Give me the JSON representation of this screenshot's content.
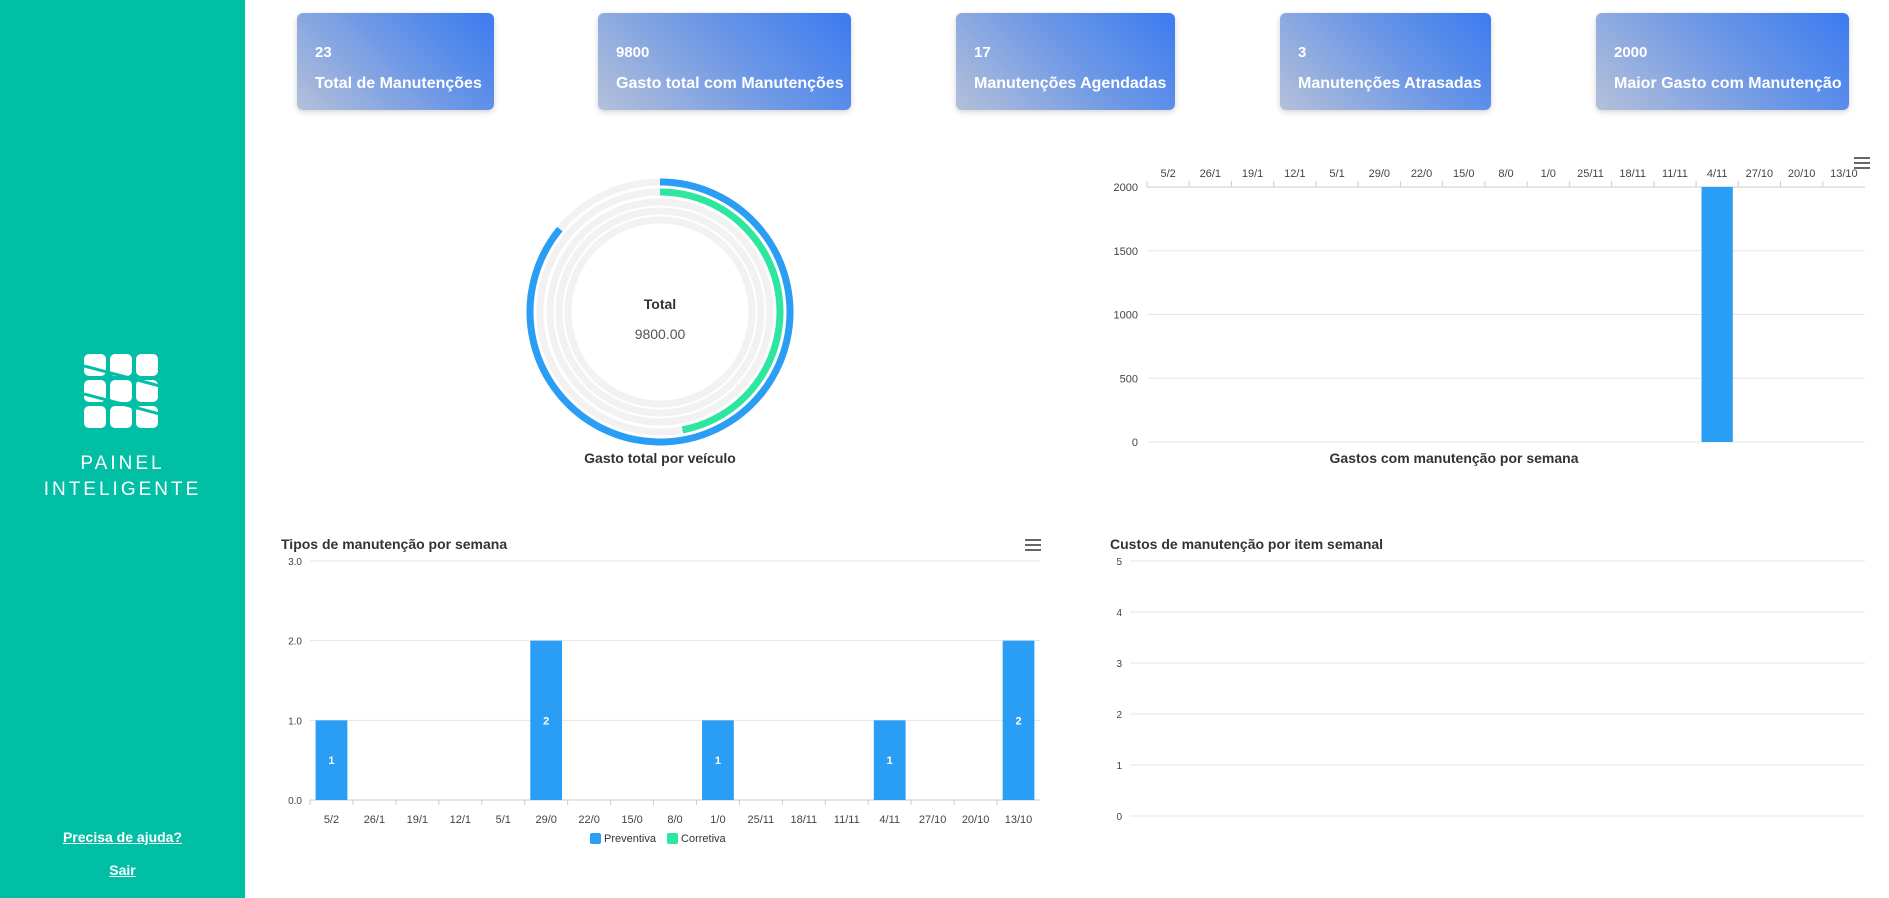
{
  "sidebar": {
    "brand_line1": "PAINEL",
    "brand_line2": "INTELIGENTE",
    "help_label": "Precisa de ajuda?",
    "logout_label": "Sair",
    "background": "#00bfa5"
  },
  "cards": [
    {
      "value": "23",
      "label": "Total de Manutenções"
    },
    {
      "value": "9800",
      "label": "Gasto total com Manutenções"
    },
    {
      "value": "17",
      "label": "Manutenções Agendadas"
    },
    {
      "value": "3",
      "label": "Manutenções Atrasadas"
    },
    {
      "value": "2000",
      "label": "Maior Gasto com Manutenção"
    }
  ],
  "charts": {
    "radial": {
      "center_title": "Total",
      "center_value": "9800.00",
      "caption": "Gasto total por veículo"
    },
    "weekly_cost": {
      "caption": "Gastos com manutenção por semana"
    },
    "types": {
      "title": "Tipos de manutenção por semana"
    },
    "items": {
      "title": "Custos de manutenção por item semanal"
    }
  },
  "chart_data": [
    {
      "type": "radialBar",
      "title": "Gasto total por veículo",
      "center_label": "Total",
      "center_value": "9800.00",
      "series_fraction": [
        0.86,
        0.47,
        0,
        0,
        0
      ],
      "colors": [
        "#2a9df4",
        "#2ee6a0"
      ]
    },
    {
      "type": "bar",
      "title": "Gastos com manutenção por semana",
      "categories": [
        "5/2",
        "26/1",
        "19/1",
        "12/1",
        "5/1",
        "29/0",
        "22/0",
        "15/0",
        "8/0",
        "1/0",
        "25/11",
        "18/11",
        "11/11",
        "4/11",
        "27/10",
        "20/10",
        "13/10"
      ],
      "series": [
        {
          "values": [
            0,
            0,
            0,
            0,
            0,
            0,
            0,
            0,
            0,
            0,
            0,
            0,
            0,
            2000,
            0,
            0,
            0
          ]
        }
      ],
      "yticks": [
        "0",
        "500",
        "1000",
        "1500",
        "2000"
      ],
      "ylim": [
        0,
        2000
      ],
      "xaxis_position": "top",
      "color": "#2a9df4"
    },
    {
      "type": "bar",
      "title": "Tipos de manutenção por semana",
      "categories": [
        "5/2",
        "26/1",
        "19/1",
        "12/1",
        "5/1",
        "29/0",
        "22/0",
        "15/0",
        "8/0",
        "1/0",
        "25/11",
        "18/11",
        "11/11",
        "4/11",
        "27/10",
        "20/10",
        "13/10"
      ],
      "series": [
        {
          "name": "Preventiva",
          "values": [
            1,
            0,
            0,
            0,
            0,
            2,
            0,
            0,
            0,
            1,
            0,
            0,
            0,
            1,
            0,
            0,
            2
          ],
          "color": "#2a9df4"
        },
        {
          "name": "Corretiva",
          "values": [
            0,
            0,
            0,
            0,
            0,
            0,
            0,
            0,
            0,
            0,
            0,
            0,
            0,
            0,
            0,
            0,
            0
          ],
          "color": "#2ee6a0"
        }
      ],
      "yticks": [
        "0.0",
        "1.0",
        "2.0",
        "3.0"
      ],
      "ylim": [
        0,
        3
      ],
      "legend": "bottom"
    },
    {
      "type": "bar",
      "title": "Custos de manutenção por item semanal",
      "categories": [],
      "series": [],
      "yticks": [
        "0",
        "1",
        "2",
        "3",
        "4",
        "5"
      ],
      "ylim": [
        0,
        5
      ]
    }
  ]
}
